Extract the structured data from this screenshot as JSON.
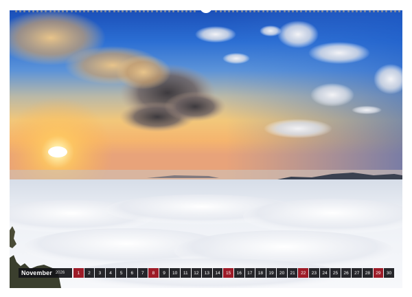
{
  "calendar": {
    "month": "November",
    "year": "2026",
    "days": [
      "1",
      "2",
      "3",
      "4",
      "5",
      "6",
      "7",
      "8",
      "9",
      "10",
      "11",
      "12",
      "13",
      "14",
      "15",
      "16",
      "17",
      "18",
      "19",
      "20",
      "21",
      "22",
      "23",
      "24",
      "25",
      "26",
      "27",
      "28",
      "29",
      "30"
    ],
    "highlighted_days": [
      "1",
      "8",
      "15",
      "22",
      "29"
    ],
    "highlight_color": "#9d1c28"
  },
  "photo": {
    "subject": "sunrise-above-sea-of-clouds"
  }
}
